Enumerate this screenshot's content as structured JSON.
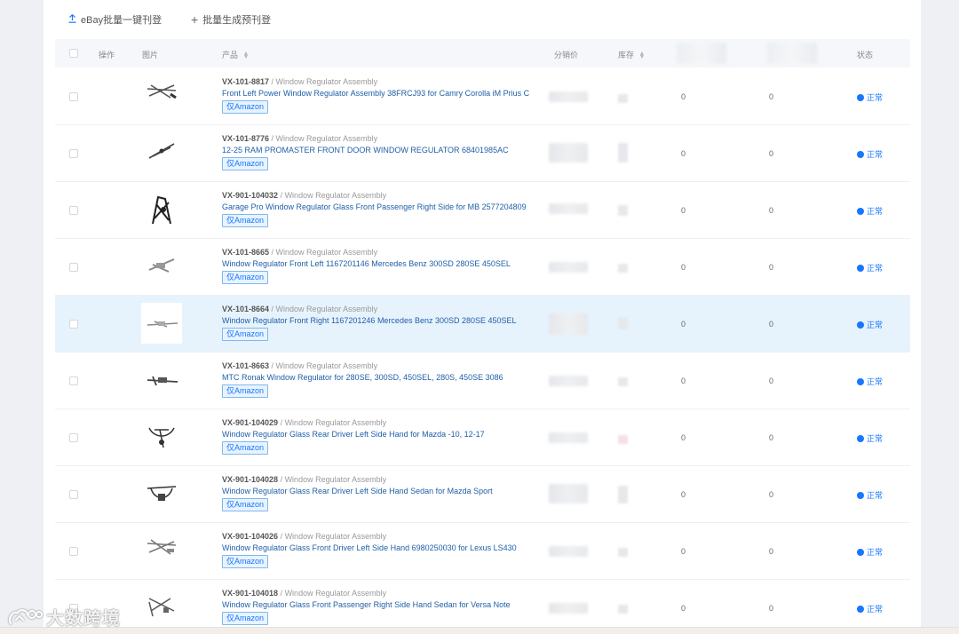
{
  "toolbar": {
    "ebay_bulk_label": "eBay批量一键刊登",
    "bulk_generate_label": "批量生成预刊登"
  },
  "table": {
    "columns": {
      "action": "操作",
      "image": "图片",
      "product": "产品",
      "price": "分销价",
      "stock": "库存",
      "status": "状态"
    },
    "rows": [
      {
        "sku": "VX-101-8817",
        "category": " / Window Regulator Assembly",
        "title": "Front Left Power Window Regulator Assembly 38FRCJ93 for Camry Corolla iM Prius C",
        "tag": "仅Amazon",
        "col_a": "0",
        "col_b": "0",
        "status": "正常"
      },
      {
        "sku": "VX-101-8776",
        "category": " / Window Regulator Assembly",
        "title": "12-25 RAM PROMASTER FRONT DOOR WINDOW REGULATOR 68401985AC",
        "tag": "仅Amazon",
        "col_a": "0",
        "col_b": "0",
        "status": "正常"
      },
      {
        "sku": "VX-901-104032",
        "category": " / Window Regulator Assembly",
        "title": "Garage Pro Window Regulator Glass Front Passenger Right Side for MB 2577204809",
        "tag": "仅Amazon",
        "col_a": "0",
        "col_b": "0",
        "status": "正常"
      },
      {
        "sku": "VX-101-8665",
        "category": " / Window Regulator Assembly",
        "title": "Window Regulator Front Left 1167201146 Mercedes Benz 300SD 280SE 450SEL",
        "tag": "仅Amazon",
        "col_a": "0",
        "col_b": "0",
        "status": "正常"
      },
      {
        "sku": "VX-101-8664",
        "category": " / Window Regulator Assembly",
        "title": "Window Regulator Front Right 1167201246 Mercedes Benz 300SD 280SE 450SEL",
        "tag": "仅Amazon",
        "col_a": "0",
        "col_b": "0",
        "status": "正常"
      },
      {
        "sku": "VX-101-8663",
        "category": " / Window Regulator Assembly",
        "title": "MTC Ronak Window Regulator for 280SE, 300SD, 450SEL, 280S, 450SE 3086",
        "tag": "仅Amazon",
        "col_a": "0",
        "col_b": "0",
        "status": "正常"
      },
      {
        "sku": "VX-901-104029",
        "category": " / Window Regulator Assembly",
        "title": "Window Regulator Glass Rear Driver Left Side Hand for Mazda -10, 12-17",
        "tag": "仅Amazon",
        "col_a": "0",
        "col_b": "0",
        "status": "正常"
      },
      {
        "sku": "VX-901-104028",
        "category": " / Window Regulator Assembly",
        "title": "Window Regulator Glass Rear Driver Left Side Hand Sedan for Mazda Sport",
        "tag": "仅Amazon",
        "col_a": "0",
        "col_b": "0",
        "status": "正常"
      },
      {
        "sku": "VX-901-104026",
        "category": " / Window Regulator Assembly",
        "title": "Window Regulator Glass Front Driver Left Side Hand 6980250030 for Lexus LS430",
        "tag": "仅Amazon",
        "col_a": "0",
        "col_b": "0",
        "status": "正常"
      },
      {
        "sku": "VX-901-104018",
        "category": " / Window Regulator Assembly",
        "title": "Window Regulator Glass Front Passenger Right Side Hand Sedan for Versa Note",
        "tag": "仅Amazon",
        "col_a": "0",
        "col_b": "0",
        "status": "正常"
      }
    ]
  },
  "watermark": {
    "text": "大数跨境"
  },
  "colors": {
    "accent": "#1677ff",
    "highlight_row": "#e6f3fc",
    "link": "#1f5fa8"
  }
}
